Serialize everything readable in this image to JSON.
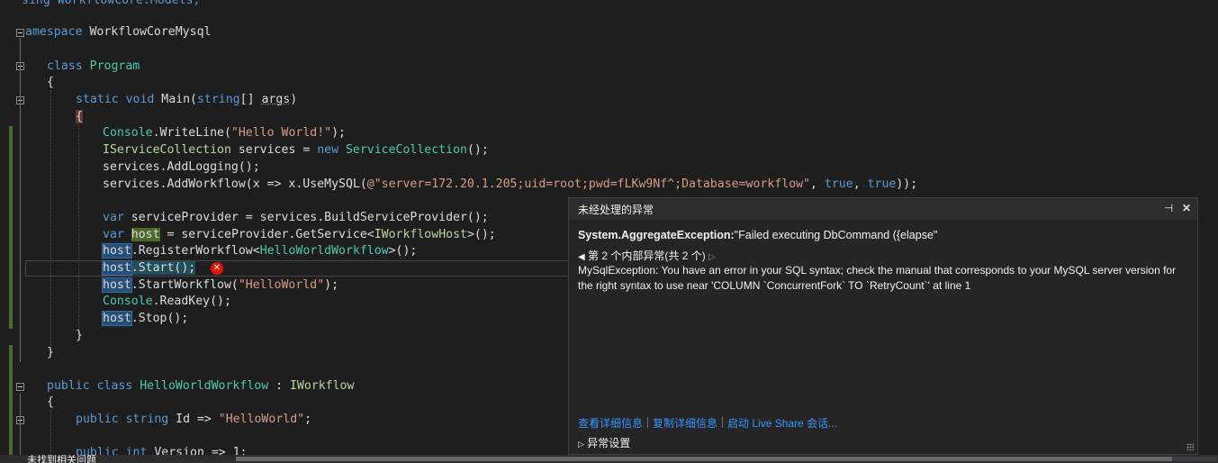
{
  "code": {
    "line_top_partial": "sing WorkflowCore.Models;",
    "ns_kw": "amespace",
    "ns_name": " WorkflowCoreMysql",
    "class_kw": "class",
    "class_name": " Program",
    "brace_open": "{",
    "brace_close": "}",
    "static_kw": "static",
    "void_kw": " void",
    "main_name": " Main(",
    "string_kw": "string",
    "main_params_a": "[] ",
    "main_param": "args",
    "main_params_b": ")",
    "l1_console": "Console",
    "l1_rest": ".WriteLine(",
    "l1_str": "\"Hello World!\"",
    "l1_end": ");",
    "l2_iface": "IServiceCollection",
    "l2_mid": " services = ",
    "l2_new": "new",
    "l2_type": " ServiceCollection",
    "l2_end": "();",
    "l3": "services.AddLogging();",
    "l4_a": "services.AddWorkflow(x => x.UseMySQL(",
    "l4_str": "@\"server=172.20.1.205;uid=root;pwd=fLKw9Nf^;Database=workflow\"",
    "l4_b": ", ",
    "l4_true1": "true",
    "l4_c": ", ",
    "l4_true2": "true",
    "l4_d": "));",
    "l5_var": "var",
    "l5_rest": " serviceProvider = services.BuildServiceProvider();",
    "l6_var": "var",
    "l6_host": "host",
    "l6_mid": " = serviceProvider.GetService<",
    "l6_iface": "IWorkflowHost",
    "l6_end": ">();",
    "host": "host",
    "l7_rest": ".RegisterWorkflow<",
    "l7_type": "HelloWorldWorkflow",
    "l7_end": ">();",
    "l8_rest": ".Start();",
    "l9_rest": ".StartWorkflow(",
    "l9_str": "\"HelloWorld\"",
    "l9_end": ");",
    "l10_console": "Console",
    "l10_rest": ".ReadKey();",
    "l11_rest": ".Stop();",
    "public_kw": "public",
    "class_kw2": " class",
    "hw_name": " HelloWorldWorkflow",
    "hw_colon": " : ",
    "hw_iface": "IWorkflow",
    "id_public": "public",
    "id_string": " string",
    "id_rest": " Id => ",
    "id_str": "\"HelloWorld\"",
    "id_end": ";",
    "ver_public": "public",
    "ver_int": " int",
    "ver_rest": " Version => 1;"
  },
  "error_icon": "✕",
  "popup": {
    "title": "未经处理的异常",
    "pin_icon": "⊣",
    "close_icon": "✕",
    "exception_type": "System.AggregateException:",
    "exception_summary": "\"Failed executing DbCommand ({elapse\"",
    "inner_nav": "第 2 个内部异常(共 2 个)",
    "prev_icon": "◀",
    "next_icon": "▷",
    "message": "MySqlException: You have an error in your SQL syntax; check the manual that corresponds to your MySQL server version for the right syntax to use near 'COLUMN `ConcurrentFork` TO `RetryCount`' at line 1",
    "link_details": "查看详细信息",
    "link_copy": "复制详细信息",
    "link_liveshare": "启动 Live Share 会话...",
    "settings_icon": "▷",
    "settings": "异常设置"
  },
  "status": {
    "text": "未找到相关问题"
  }
}
